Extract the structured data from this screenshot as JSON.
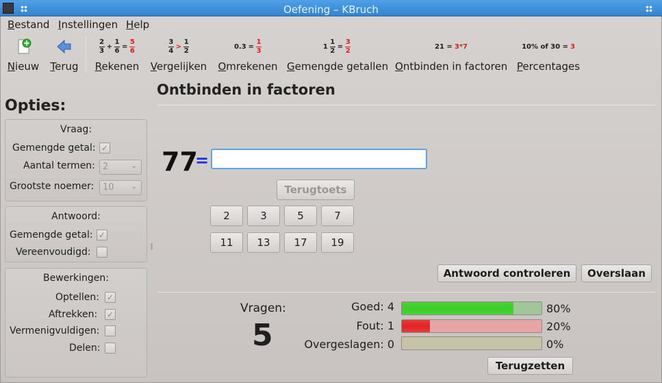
{
  "window": {
    "title": "Oefening – KBruch"
  },
  "menu": [
    "Bestand",
    "Instellingen",
    "Help"
  ],
  "toolbar": {
    "new_label": "Nieuw",
    "back_label": "Terug",
    "modes": [
      {
        "label": "Rekenen"
      },
      {
        "label": "Vergelijken"
      },
      {
        "label": "Omrekenen"
      },
      {
        "label": "Gemengde getallen"
      },
      {
        "label": "Ontbinden in factoren"
      },
      {
        "label": "Percentages"
      }
    ],
    "icons": {
      "rekenen": {
        "a_num": "2",
        "a_den": "3",
        "op": "+",
        "b_num": "1",
        "b_den": "6",
        "eq": "=",
        "r_num": "5",
        "r_den": "6"
      },
      "vergelijken": {
        "a_num": "3",
        "a_den": "4",
        "op": ">",
        "b_num": "1",
        "b_den": "2"
      },
      "omrekenen": {
        "left": "0.3",
        "overline": "3",
        "eq": "=",
        "r_num": "1",
        "r_den": "3"
      },
      "gemengd": {
        "whole": "1",
        "a_num": "1",
        "a_den": "2",
        "eq": "=",
        "r_num": "3",
        "r_den": "2"
      },
      "factoren": {
        "left": "21 =",
        "right": "3*7"
      },
      "percentages": {
        "left": "10% of 30 =",
        "right": "3"
      }
    }
  },
  "sidebar": {
    "title": "Opties:",
    "vraag": {
      "title": "Vraag:",
      "mixed_label": "Gemengde getal:",
      "terms_label": "Aantal termen:",
      "terms_value": "2",
      "denominator_label": "Grootste noemer:",
      "denominator_value": "10"
    },
    "antwoord": {
      "title": "Antwoord:",
      "mixed_label": "Gemengde getal:",
      "simplified_label": "Vereenvoudigd:"
    },
    "bewerkingen": {
      "title": "Bewerkingen:",
      "items": [
        "Optellen:",
        "Aftrekken:",
        "Vermenigvuldigen:",
        "Delen:"
      ]
    },
    "check_mark": "✓"
  },
  "main": {
    "title": "Ontbinden in factoren",
    "task_number": "77",
    "equals": "=",
    "input_value": "",
    "backspace_label": "Terugtoets",
    "factor_buttons": [
      "2",
      "3",
      "5",
      "7",
      "11",
      "13",
      "17",
      "19"
    ],
    "check_label": "Antwoord controleren",
    "skip_label": "Overslaan"
  },
  "stats": {
    "questions_label": "Vragen:",
    "questions_value": "5",
    "correct_label": "Goed: 4",
    "correct_pct": "80%",
    "correct_fraction": 0.8,
    "wrong_label": "Fout: 1",
    "wrong_pct": "20%",
    "wrong_fraction": 0.2,
    "skipped_label": "Overgeslagen: 0",
    "skipped_pct": "0%",
    "skipped_fraction": 0,
    "reset_label": "Terugzetten",
    "colors": {
      "correct": "#3ad024",
      "wrong": "#e52222",
      "skipped": "#c0c09a"
    }
  }
}
